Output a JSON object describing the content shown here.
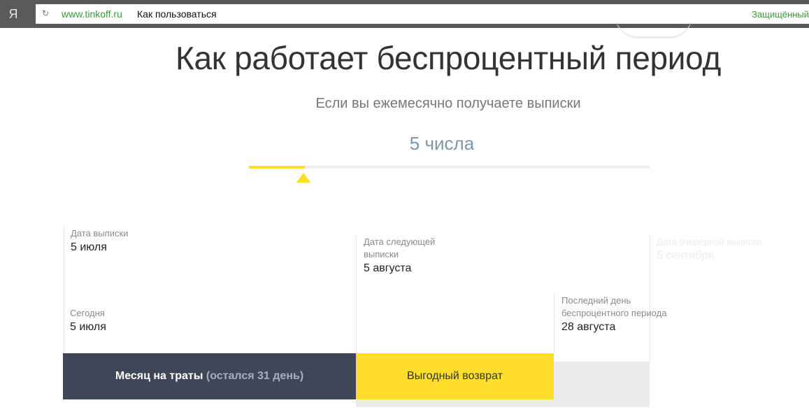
{
  "browser": {
    "logo": "Я",
    "domain": "www.tinkoff.ru",
    "tab_title": "Как пользоваться",
    "security_label": "Защищённый"
  },
  "section": {
    "title": "Как работает беспроцентный период",
    "subtitle": "Если вы ежемесячно получаете выписки",
    "selected_day": "5 числа",
    "slider_progress": 0.14
  },
  "timeline": {
    "statement": {
      "label": "Дата выписки",
      "value": "5 июля"
    },
    "today": {
      "label": "Сегодня",
      "value": "5 июля"
    },
    "next_statement": {
      "label_line1": "Дата следующей",
      "label_line2": "выписки",
      "value": "5 августа"
    },
    "last_day": {
      "label_line1": "Последний день",
      "label_line2": "беспроцентного периода",
      "value": "28 августа"
    },
    "following_statement": {
      "label": "Дата очередной выписки",
      "value": "5 сентября"
    }
  },
  "bars": {
    "spending": "Месяц на траты",
    "spending_remaining": "(остался 31 день)",
    "repayment": "Выгодный возврат"
  },
  "colors": {
    "accent_yellow": "#ffdd2d",
    "dark_bar": "#3f4757",
    "secure_green": "#3a9a3a"
  }
}
